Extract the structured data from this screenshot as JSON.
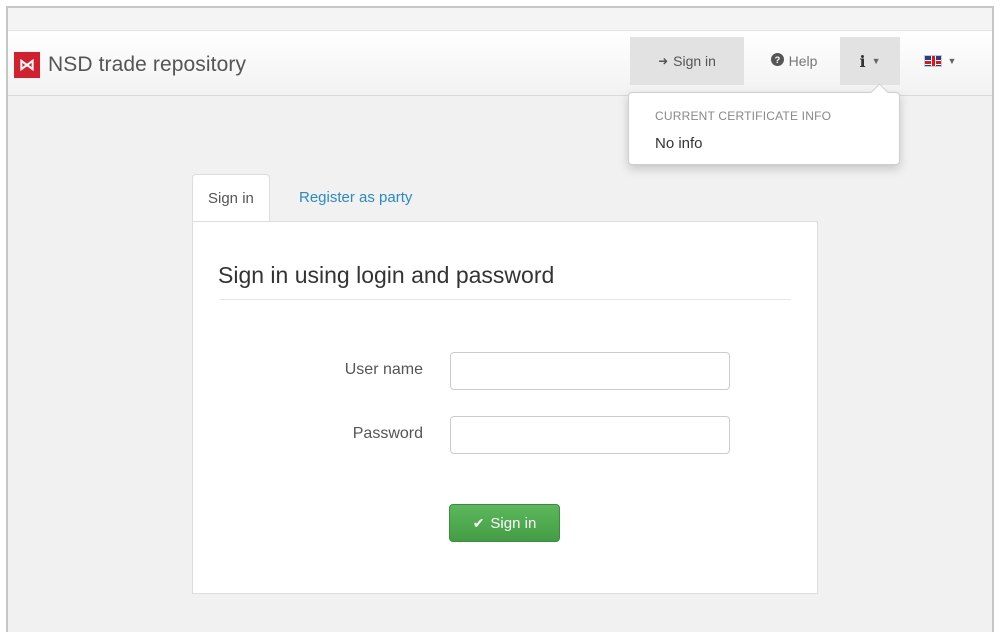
{
  "brand": {
    "logo_glyph": "⋈",
    "name": "NSD trade repository",
    "logo_color": "#d2202f"
  },
  "navbar": {
    "signin": {
      "icon": "sign-in-icon",
      "glyph": "➜",
      "label": "Sign in"
    },
    "help": {
      "icon": "question-circle-icon",
      "glyph": "❓",
      "label": "Help"
    },
    "info": {
      "icon": "info-icon",
      "glyph": "i"
    },
    "language": {
      "icon": "uk-flag-icon"
    }
  },
  "dropdown": {
    "header": "CURRENT CERTIFICATE INFO",
    "item": "No info"
  },
  "tabs": [
    {
      "label": "Sign in",
      "active": true
    },
    {
      "label": "Register as party",
      "active": false
    }
  ],
  "form": {
    "title": "Sign in using login and password",
    "username_label": "User name",
    "username_value": "",
    "password_label": "Password",
    "password_value": "",
    "submit_label": "Sign in",
    "submit_icon": "check-icon",
    "submit_color": "#5cb85c"
  },
  "colors": {
    "link": "#2a8ac6",
    "accent_red": "#d2202f"
  }
}
